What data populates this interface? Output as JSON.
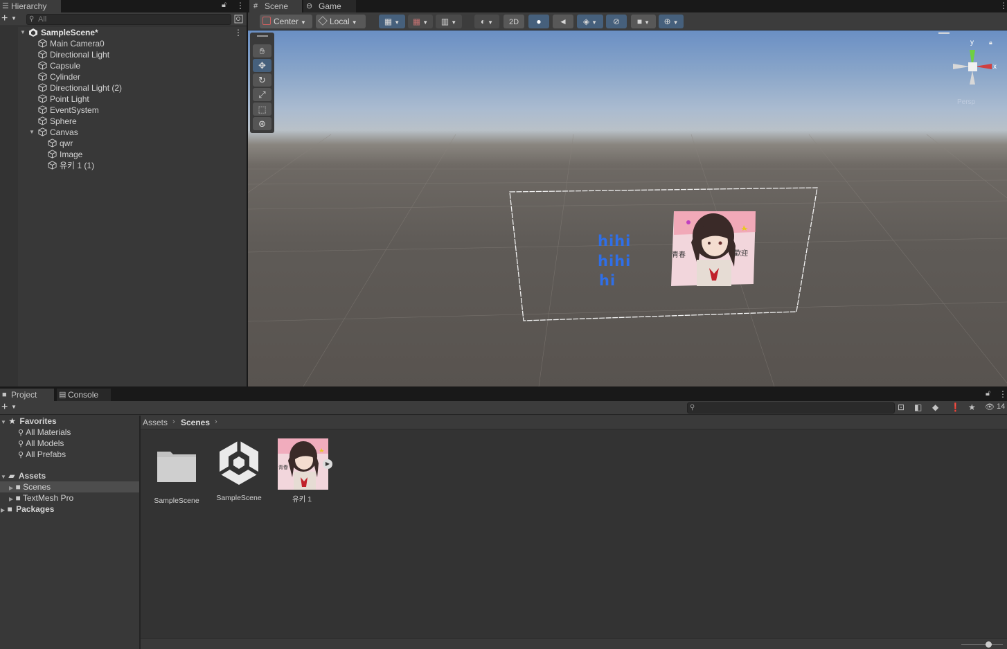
{
  "hierarchy": {
    "tab_label": "Hierarchy",
    "search_placeholder": "All",
    "scene_name": "SampleScene*",
    "items": [
      {
        "label": "Main Camera0"
      },
      {
        "label": "Directional Light"
      },
      {
        "label": "Capsule"
      },
      {
        "label": "Cylinder"
      },
      {
        "label": "Directional Light (2)"
      },
      {
        "label": "Point Light"
      },
      {
        "label": "EventSystem"
      },
      {
        "label": "Sphere"
      },
      {
        "label": "Canvas"
      }
    ],
    "canvas_children": [
      {
        "label": "qwr"
      },
      {
        "label": "Image"
      },
      {
        "label": "유키 1 (1)"
      }
    ]
  },
  "scene": {
    "tabs": [
      {
        "label": "Scene"
      },
      {
        "label": "Game"
      }
    ],
    "toolbar": {
      "pivot_label": "Center",
      "space_label": "Local",
      "mode_2d_label": "2D"
    },
    "gizmo_labels": {
      "y": "y",
      "x": "x",
      "persp": "Persp"
    },
    "canvas_text_lines": [
      "hihi",
      "hihi",
      "hi"
    ]
  },
  "project": {
    "tabs": [
      {
        "label": "Project"
      },
      {
        "label": "Console"
      }
    ],
    "favorites_label": "Favorites",
    "favorites": [
      {
        "label": "All Materials"
      },
      {
        "label": "All Models"
      },
      {
        "label": "All Prefabs"
      }
    ],
    "assets_label": "Assets",
    "asset_folders": [
      {
        "label": "Scenes"
      },
      {
        "label": "TextMesh Pro"
      }
    ],
    "packages_label": "Packages",
    "breadcrumb": [
      "Assets",
      "Scenes"
    ],
    "hidden_count": "14",
    "assets": [
      {
        "label": "SampleScene",
        "kind": "folder"
      },
      {
        "label": "SampleScene",
        "kind": "unity-scene"
      },
      {
        "label": "유키 1",
        "kind": "image"
      }
    ]
  },
  "colors": {
    "selection": "#46607c",
    "canvas_text": "#2f6fe8"
  }
}
